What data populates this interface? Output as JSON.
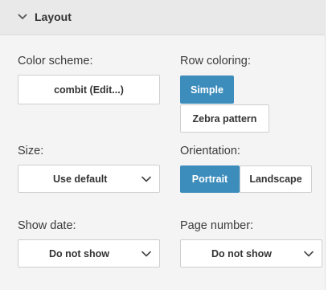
{
  "section": {
    "title": "Layout"
  },
  "color_scheme": {
    "label": "Color scheme:",
    "button": "combit (Edit...)"
  },
  "row_coloring": {
    "label": "Row coloring:",
    "options": [
      "Simple",
      "Zebra pattern"
    ],
    "selected": "Simple"
  },
  "size": {
    "label": "Size:",
    "value": "Use default"
  },
  "orientation": {
    "label": "Orientation:",
    "options": [
      "Portrait",
      "Landscape"
    ],
    "selected": "Portrait"
  },
  "show_date": {
    "label": "Show date:",
    "value": "Do not show"
  },
  "page_number": {
    "label": "Page number:",
    "value": "Do not show"
  },
  "colors": {
    "accent": "#3c8dbc",
    "panel": "#f4f4f4",
    "header": "#e9e9e9"
  },
  "icons": {
    "header": "chevron-down-icon",
    "dropdown": "chevron-down-icon"
  }
}
